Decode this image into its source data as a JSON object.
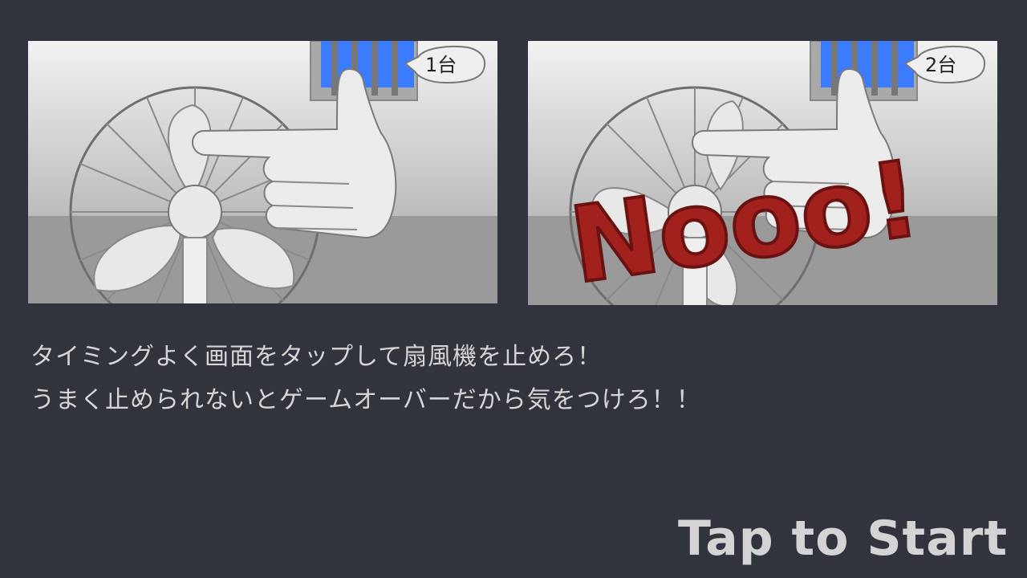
{
  "tutorial": {
    "panels": [
      {
        "counter": "1台",
        "show_fail": false
      },
      {
        "counter": "2台",
        "show_fail": true,
        "fail_text": "Nooo!"
      }
    ]
  },
  "instructions": {
    "line1": "タイミングよく画面をタップして扇風機を止めろ！",
    "line2": "うまく止められないとゲームオーバーだから気をつけろ！！"
  },
  "start": {
    "label": "Tap to Start"
  },
  "colors": {
    "background": "#31343c",
    "text": "#d6d6d6",
    "vent_blue": "#3a7bff",
    "fail_red": "#a3211d"
  }
}
